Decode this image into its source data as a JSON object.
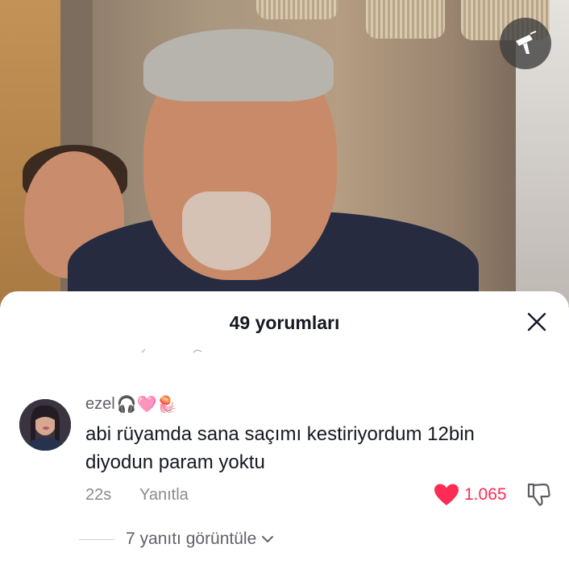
{
  "header": {
    "title": "49 yorumları"
  },
  "comment": {
    "username": "ezel",
    "username_emojis": "🎧🩷🪼",
    "text": "abi rüyamda sana saçımı kestiriyordum 12bin diyodun param yoktu",
    "time": "22s",
    "reply_label": "Yanıtla",
    "likes": "1.065",
    "view_replies_label": "7 yanıtı görüntüle"
  },
  "colors": {
    "like": "#fe2c55",
    "text": "#161823",
    "muted": "#8a8b91"
  },
  "icons": [
    "effect-icon",
    "close-icon",
    "heart-icon",
    "dislike-icon",
    "chevron-down-icon"
  ]
}
